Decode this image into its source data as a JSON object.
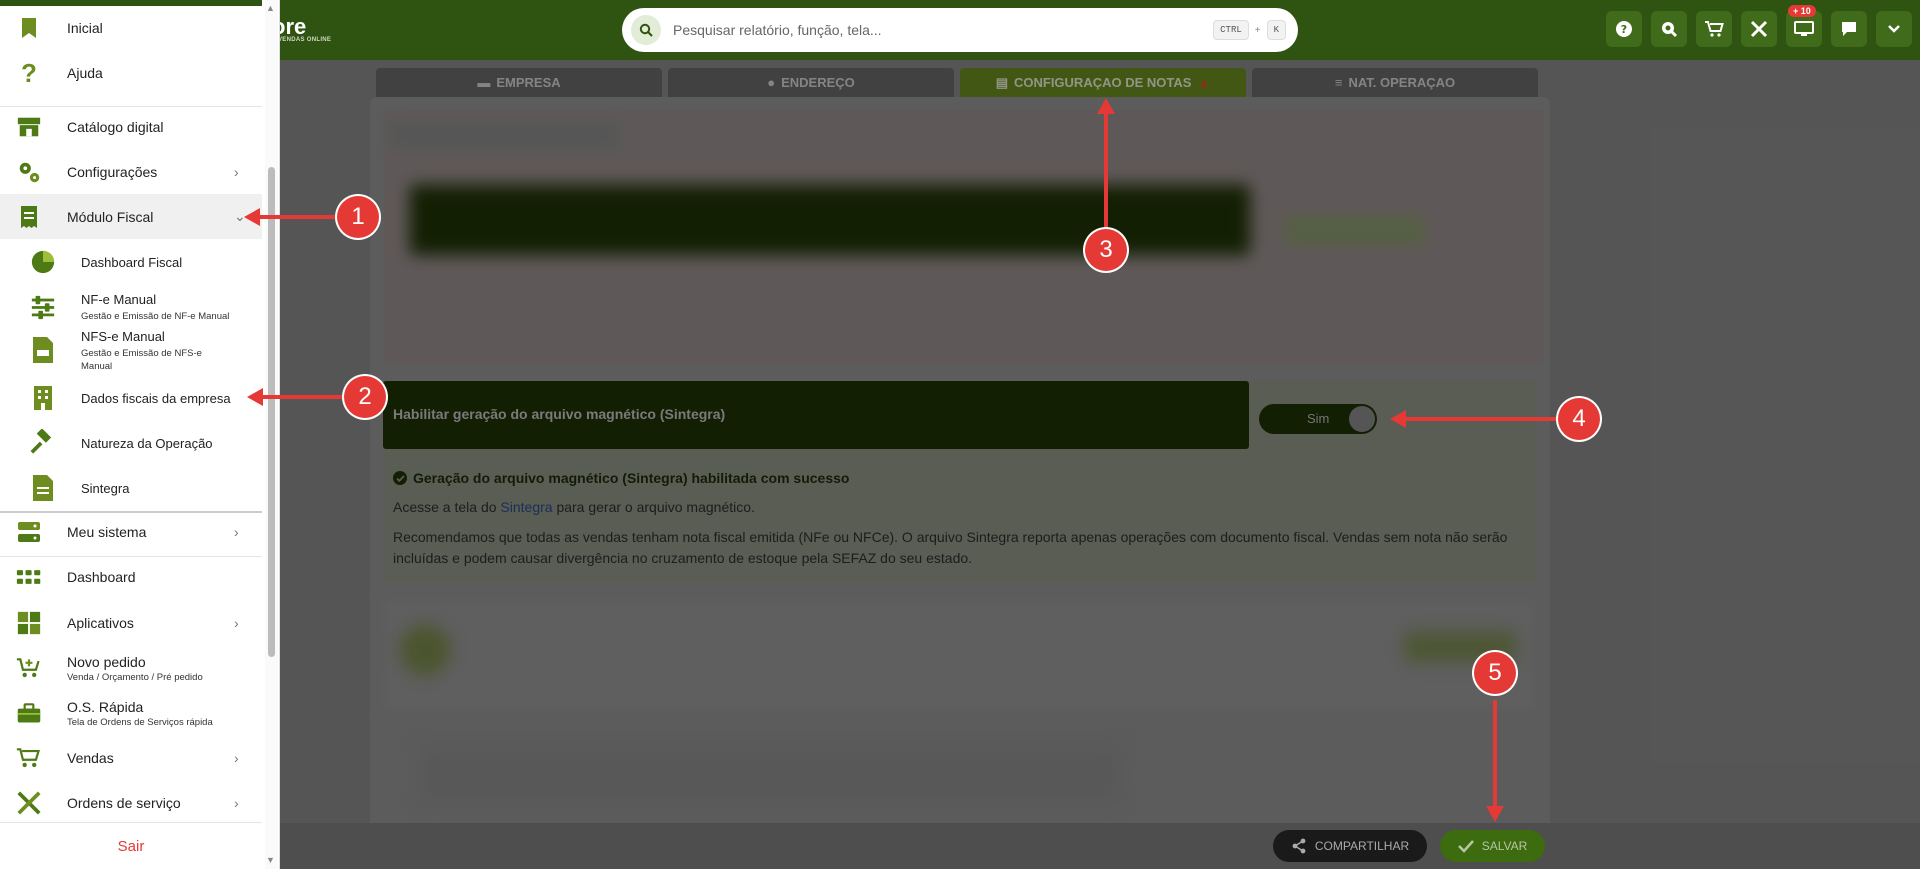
{
  "header": {
    "logo_text": "ore",
    "logo_sub": "VENDAS ONLINE",
    "search_placeholder": "Pesquisar relatório, função, tela...",
    "shortcut_key1": "CTRL",
    "shortcut_plus": "+",
    "shortcut_key2": "K",
    "notification_badge": "+ 10",
    "icons": [
      "help-icon",
      "zoom-icon",
      "cart-icon",
      "tools-icon",
      "monitor-icon",
      "chat-icon",
      "chevron-down-icon"
    ]
  },
  "tabs": [
    {
      "label": "EMPRESA",
      "icon": "card-icon",
      "active": false
    },
    {
      "label": "ENDEREÇO",
      "icon": "location-icon",
      "active": false
    },
    {
      "label": "CONFIGURAÇAO DE NOTAS",
      "icon": "document-icon",
      "active": true
    },
    {
      "label": "NAT. OPERAÇAO",
      "icon": "list-icon",
      "active": false
    }
  ],
  "sintegra": {
    "label": "Habilitar geração do arquivo magnético (Sintegra)",
    "toggle_value": "Sim",
    "success_msg": "Geração do arquivo magnético (Sintegra) habilitada com sucesso",
    "access_prefix": "Acesse a tela do ",
    "access_link": "Sintegra",
    "access_suffix": " para gerar o arquivo magnético.",
    "recommendation": "Recomendamos que todas as vendas tenham nota fiscal emitida (NFe ou NFCe). O arquivo Sintegra reporta apenas operações com documento fiscal. Vendas sem nota não serão incluídas e podem causar divergência no cruzamento de estoque pela SEFAZ do seu estado."
  },
  "footer": {
    "share_label": "COMPARTILHAR",
    "save_label": "SALVAR"
  },
  "sidebar": {
    "items": [
      {
        "label": "Inicial",
        "icon": "bookmark-icon"
      },
      {
        "label": "Ajuda",
        "icon": "question-icon"
      },
      {
        "label": "Catálogo digital",
        "icon": "store-icon"
      },
      {
        "label": "Configurações",
        "icon": "gears-icon"
      },
      {
        "label": "Módulo Fiscal",
        "icon": "receipt-icon"
      },
      {
        "label": "Meu sistema",
        "icon": "server-icon"
      },
      {
        "label": "Dashboard",
        "icon": "grid-icon"
      },
      {
        "label": "Aplicativos",
        "icon": "puzzle-icon"
      },
      {
        "label": "Novo pedido",
        "desc": "Venda / Orçamento / Pré pedido",
        "icon": "cart-plus-icon"
      },
      {
        "label": "O.S. Rápida",
        "desc": "Tela de Ordens de Serviços rápida",
        "icon": "toolbox-icon"
      },
      {
        "label": "Vendas",
        "icon": "cart-icon"
      },
      {
        "label": "Ordens de serviço",
        "icon": "tools-icon"
      }
    ],
    "fiscal_sub": [
      {
        "label": "Dashboard Fiscal",
        "icon": "pie-icon"
      },
      {
        "label": "NF-e Manual",
        "desc": "Gestão e Emissão de NF-e Manual",
        "icon": "sliders-icon"
      },
      {
        "label": "NFS-e Manual",
        "desc": "Gestão e Emissão de NFS-e Manual",
        "icon": "file-icon"
      },
      {
        "label": "Dados fiscais da empresa",
        "icon": "building-icon"
      },
      {
        "label": "Natureza da Operação",
        "icon": "gavel-icon"
      },
      {
        "label": "Sintegra",
        "icon": "file-text-icon"
      }
    ],
    "logout_label": "Sair"
  },
  "annotations": [
    "1",
    "2",
    "3",
    "4",
    "5"
  ],
  "colors": {
    "brand_green": "#2f5412",
    "accent_green": "#6d8d21",
    "annotation_red": "#e53935"
  }
}
